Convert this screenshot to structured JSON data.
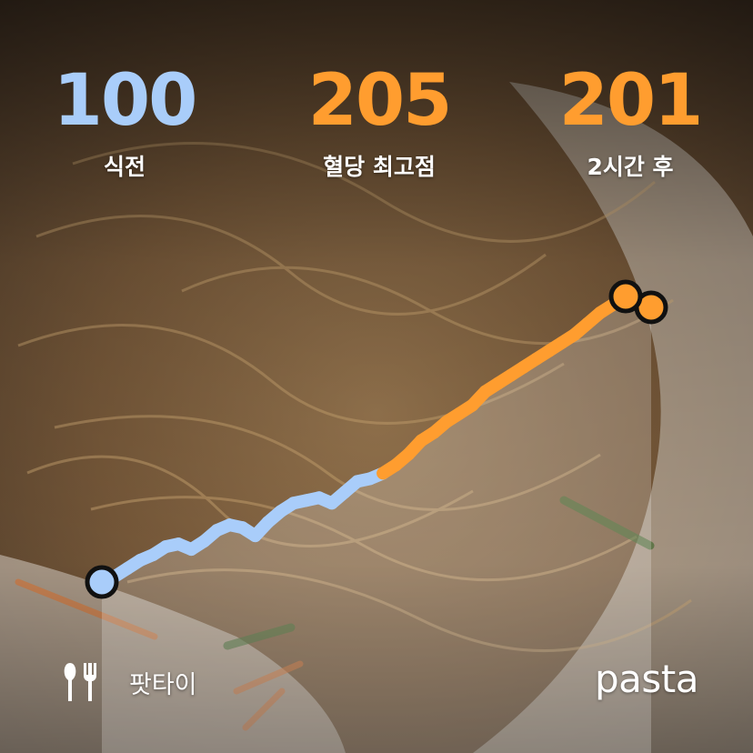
{
  "stats": {
    "before": {
      "value": "100",
      "label": "식전",
      "color": "#a9cdfa"
    },
    "peak": {
      "value": "205",
      "label": "혈당 최고점",
      "color": "#ff9d2f"
    },
    "after": {
      "value": "201",
      "label": "2시간 후",
      "color": "#ff9d2f"
    }
  },
  "chart_data": {
    "type": "line",
    "ylim": [
      100,
      205
    ],
    "threshold": 140,
    "series": [
      {
        "values": [
          100,
          102,
          105,
          108,
          110,
          113,
          114,
          112,
          115,
          119,
          121,
          120,
          117,
          122,
          126,
          129,
          130,
          131,
          129,
          133,
          137,
          138,
          140,
          143,
          147,
          152,
          155,
          159,
          162,
          165,
          170,
          173,
          176,
          179,
          182,
          185,
          188,
          191,
          195,
          199,
          202,
          205
        ]
      }
    ],
    "end_value": 201,
    "colors": {
      "below": "#a9cdfa",
      "above": "#ff9d2f"
    }
  },
  "food": {
    "name": "팟타이",
    "icon": "utensils-icon"
  },
  "brand": {
    "name": "pasta"
  }
}
